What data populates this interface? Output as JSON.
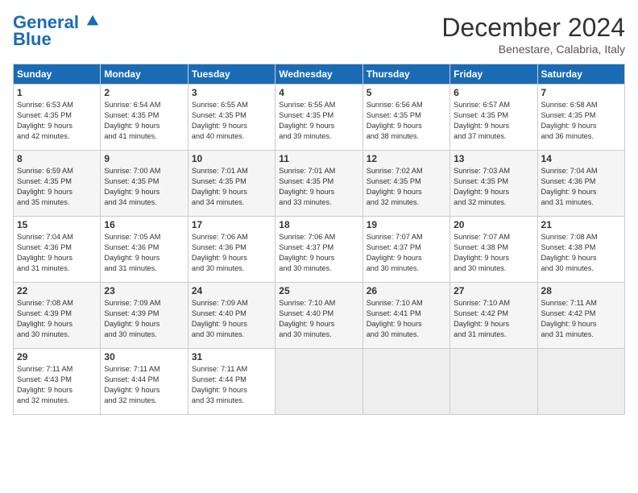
{
  "header": {
    "logo_line1": "General",
    "logo_line2": "Blue",
    "month": "December 2024",
    "location": "Benestare, Calabria, Italy"
  },
  "days_of_week": [
    "Sunday",
    "Monday",
    "Tuesday",
    "Wednesday",
    "Thursday",
    "Friday",
    "Saturday"
  ],
  "weeks": [
    [
      {
        "day": "1",
        "text": "Sunrise: 6:53 AM\nSunset: 4:35 PM\nDaylight: 9 hours\nand 42 minutes."
      },
      {
        "day": "2",
        "text": "Sunrise: 6:54 AM\nSunset: 4:35 PM\nDaylight: 9 hours\nand 41 minutes."
      },
      {
        "day": "3",
        "text": "Sunrise: 6:55 AM\nSunset: 4:35 PM\nDaylight: 9 hours\nand 40 minutes."
      },
      {
        "day": "4",
        "text": "Sunrise: 6:55 AM\nSunset: 4:35 PM\nDaylight: 9 hours\nand 39 minutes."
      },
      {
        "day": "5",
        "text": "Sunrise: 6:56 AM\nSunset: 4:35 PM\nDaylight: 9 hours\nand 38 minutes."
      },
      {
        "day": "6",
        "text": "Sunrise: 6:57 AM\nSunset: 4:35 PM\nDaylight: 9 hours\nand 37 minutes."
      },
      {
        "day": "7",
        "text": "Sunrise: 6:58 AM\nSunset: 4:35 PM\nDaylight: 9 hours\nand 36 minutes."
      }
    ],
    [
      {
        "day": "8",
        "text": "Sunrise: 6:59 AM\nSunset: 4:35 PM\nDaylight: 9 hours\nand 35 minutes."
      },
      {
        "day": "9",
        "text": "Sunrise: 7:00 AM\nSunset: 4:35 PM\nDaylight: 9 hours\nand 34 minutes."
      },
      {
        "day": "10",
        "text": "Sunrise: 7:01 AM\nSunset: 4:35 PM\nDaylight: 9 hours\nand 34 minutes."
      },
      {
        "day": "11",
        "text": "Sunrise: 7:01 AM\nSunset: 4:35 PM\nDaylight: 9 hours\nand 33 minutes."
      },
      {
        "day": "12",
        "text": "Sunrise: 7:02 AM\nSunset: 4:35 PM\nDaylight: 9 hours\nand 32 minutes."
      },
      {
        "day": "13",
        "text": "Sunrise: 7:03 AM\nSunset: 4:35 PM\nDaylight: 9 hours\nand 32 minutes."
      },
      {
        "day": "14",
        "text": "Sunrise: 7:04 AM\nSunset: 4:36 PM\nDaylight: 9 hours\nand 31 minutes."
      }
    ],
    [
      {
        "day": "15",
        "text": "Sunrise: 7:04 AM\nSunset: 4:36 PM\nDaylight: 9 hours\nand 31 minutes."
      },
      {
        "day": "16",
        "text": "Sunrise: 7:05 AM\nSunset: 4:36 PM\nDaylight: 9 hours\nand 31 minutes."
      },
      {
        "day": "17",
        "text": "Sunrise: 7:06 AM\nSunset: 4:36 PM\nDaylight: 9 hours\nand 30 minutes."
      },
      {
        "day": "18",
        "text": "Sunrise: 7:06 AM\nSunset: 4:37 PM\nDaylight: 9 hours\nand 30 minutes."
      },
      {
        "day": "19",
        "text": "Sunrise: 7:07 AM\nSunset: 4:37 PM\nDaylight: 9 hours\nand 30 minutes."
      },
      {
        "day": "20",
        "text": "Sunrise: 7:07 AM\nSunset: 4:38 PM\nDaylight: 9 hours\nand 30 minutes."
      },
      {
        "day": "21",
        "text": "Sunrise: 7:08 AM\nSunset: 4:38 PM\nDaylight: 9 hours\nand 30 minutes."
      }
    ],
    [
      {
        "day": "22",
        "text": "Sunrise: 7:08 AM\nSunset: 4:39 PM\nDaylight: 9 hours\nand 30 minutes."
      },
      {
        "day": "23",
        "text": "Sunrise: 7:09 AM\nSunset: 4:39 PM\nDaylight: 9 hours\nand 30 minutes."
      },
      {
        "day": "24",
        "text": "Sunrise: 7:09 AM\nSunset: 4:40 PM\nDaylight: 9 hours\nand 30 minutes."
      },
      {
        "day": "25",
        "text": "Sunrise: 7:10 AM\nSunset: 4:40 PM\nDaylight: 9 hours\nand 30 minutes."
      },
      {
        "day": "26",
        "text": "Sunrise: 7:10 AM\nSunset: 4:41 PM\nDaylight: 9 hours\nand 30 minutes."
      },
      {
        "day": "27",
        "text": "Sunrise: 7:10 AM\nSunset: 4:42 PM\nDaylight: 9 hours\nand 31 minutes."
      },
      {
        "day": "28",
        "text": "Sunrise: 7:11 AM\nSunset: 4:42 PM\nDaylight: 9 hours\nand 31 minutes."
      }
    ],
    [
      {
        "day": "29",
        "text": "Sunrise: 7:11 AM\nSunset: 4:43 PM\nDaylight: 9 hours\nand 32 minutes."
      },
      {
        "day": "30",
        "text": "Sunrise: 7:11 AM\nSunset: 4:44 PM\nDaylight: 9 hours\nand 32 minutes."
      },
      {
        "day": "31",
        "text": "Sunrise: 7:11 AM\nSunset: 4:44 PM\nDaylight: 9 hours\nand 33 minutes."
      },
      null,
      null,
      null,
      null
    ]
  ]
}
